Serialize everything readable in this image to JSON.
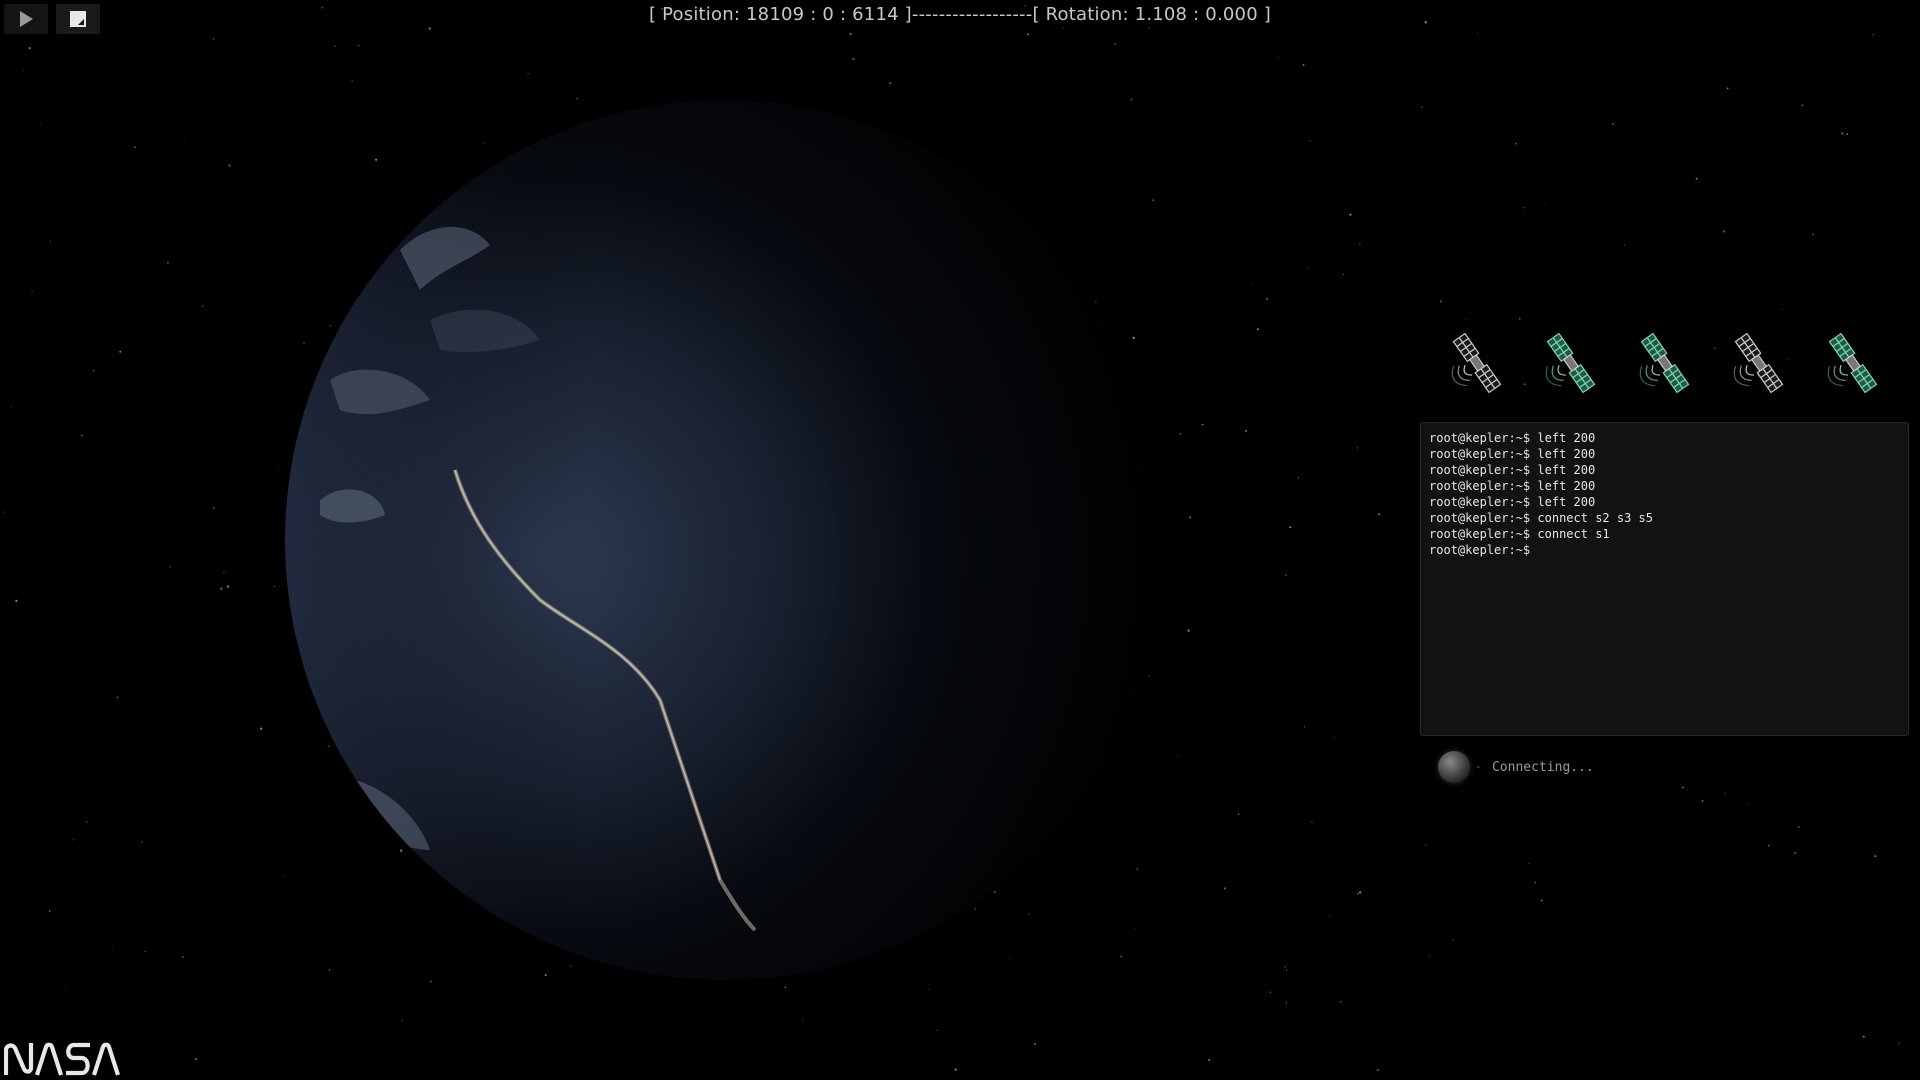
{
  "toolbar": {
    "play_icon": "play-icon",
    "fullscreen_icon": "fullscreen-icon"
  },
  "hud": {
    "position_label": "Position:",
    "position_value": "18109 : 0 : 6114",
    "separator": "------------------",
    "rotation_label": "Rotation:",
    "rotation_value": "1.108 : 0.000"
  },
  "satellites": [
    {
      "id": "s1",
      "state": "inactive",
      "color": "#cfcfcf"
    },
    {
      "id": "s2",
      "state": "active",
      "color": "#7fd9b0"
    },
    {
      "id": "s3",
      "state": "active",
      "color": "#7fd9b0"
    },
    {
      "id": "s4",
      "state": "inactive",
      "color": "#cfcfcf"
    },
    {
      "id": "s5",
      "state": "active",
      "color": "#7fd9b0"
    }
  ],
  "terminal": {
    "prompt": "root@kepler:~$",
    "lines": [
      {
        "prompt": "root@kepler:~$",
        "command": "left 200"
      },
      {
        "prompt": "root@kepler:~$",
        "command": "left 200"
      },
      {
        "prompt": "root@kepler:~$",
        "command": "left 200"
      },
      {
        "prompt": "root@kepler:~$",
        "command": "left 200"
      },
      {
        "prompt": "root@kepler:~$",
        "command": "left 200"
      },
      {
        "prompt": "root@kepler:~$",
        "command": "connect s2 s3 s5"
      },
      {
        "prompt": "root@kepler:~$",
        "command": "connect s1"
      },
      {
        "prompt": "root@kepler:~$",
        "command": ""
      }
    ]
  },
  "status": {
    "text": "Connecting..."
  },
  "logo": {
    "text": "NASA"
  },
  "colors": {
    "background": "#000000",
    "active_satellite": "#7fd9b0",
    "inactive_satellite": "#cfcfcf",
    "terminal_bg": "#121212"
  }
}
